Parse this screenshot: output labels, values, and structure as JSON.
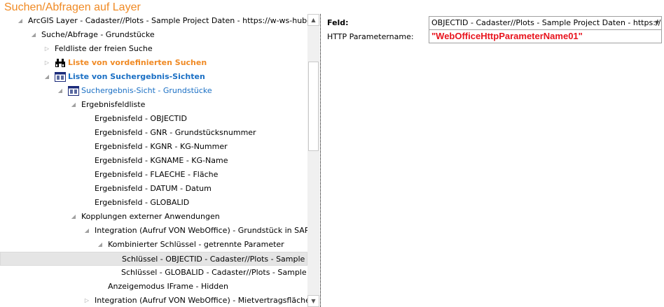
{
  "title": "Suchen/Abfragen auf Layer",
  "tree": [
    {
      "label": "ArcGIS Layer - Cadaster//Plots - Sample Project Daten - https://w-ws-huber.syn",
      "level": 0,
      "state": "expanded"
    },
    {
      "label": "Suche/Abfrage - Grundstücke",
      "level": 1,
      "state": "expanded"
    },
    {
      "label": "Feldliste der freien Suche",
      "level": 2,
      "state": "collapsed"
    },
    {
      "label": "Liste von vordefinierten Suchen",
      "level": 2,
      "state": "collapsed",
      "icon": "binoculars-icon",
      "style": "orange"
    },
    {
      "label": "Liste von Suchergebnis-Sichten",
      "level": 2,
      "state": "expanded",
      "icon": "table-view-icon",
      "style": "blueb"
    },
    {
      "label": "Suchergebnis-Sicht - Grundstücke",
      "level": 3,
      "state": "expanded",
      "icon": "table-view-icon",
      "style": "blue"
    },
    {
      "label": "Ergebnisfeldliste",
      "level": 4,
      "state": "expanded"
    },
    {
      "label": "Ergebnisfeld - OBJECTID",
      "level": 5,
      "state": "leaf"
    },
    {
      "label": "Ergebnisfeld - GNR - Grundstücksnummer",
      "level": 5,
      "state": "leaf"
    },
    {
      "label": "Ergebnisfeld - KGNR - KG-Nummer",
      "level": 5,
      "state": "leaf"
    },
    {
      "label": "Ergebnisfeld - KGNAME - KG-Name",
      "level": 5,
      "state": "leaf"
    },
    {
      "label": "Ergebnisfeld - FLAECHE - Fläche",
      "level": 5,
      "state": "leaf"
    },
    {
      "label": "Ergebnisfeld - DATUM - Datum",
      "level": 5,
      "state": "leaf"
    },
    {
      "label": "Ergebnisfeld - GLOBALID",
      "level": 5,
      "state": "leaf"
    },
    {
      "label": "Kopplungen externer Anwendungen",
      "level": 4,
      "state": "expanded"
    },
    {
      "label": "Integration (Aufruf VON WebOffice) - Grundstück in SAP öff",
      "level": 5,
      "state": "expanded"
    },
    {
      "label": "Kombinierter Schlüssel - getrennte Parameter",
      "level": 6,
      "state": "expanded"
    },
    {
      "label": "Schlüssel - OBJECTID - Cadaster//Plots - Sample Proj",
      "level": 7,
      "state": "leaf",
      "selected": true
    },
    {
      "label": "Schlüssel - GLOBALID - Cadaster//Plots - Sample Pro",
      "level": 7,
      "state": "leaf"
    },
    {
      "label": "Anzeigemodus IFrame - Hidden",
      "level": 6,
      "state": "leaf"
    },
    {
      "label": "Integration (Aufruf VON WebOffice) - Mietvertragsflächen in",
      "level": 5,
      "state": "collapsed"
    }
  ],
  "props": {
    "feld_label": "Feld:",
    "feld_value": "OBJECTID - Cadaster//Plots - Sample Project Daten - https://w-",
    "param_label": "HTTP Parametername:",
    "param_value": "\"WebOfficeHttpParameterName01\""
  },
  "colors": {
    "title": "#f08a24",
    "link": "#1a6fc4",
    "value": "#e8141e"
  }
}
